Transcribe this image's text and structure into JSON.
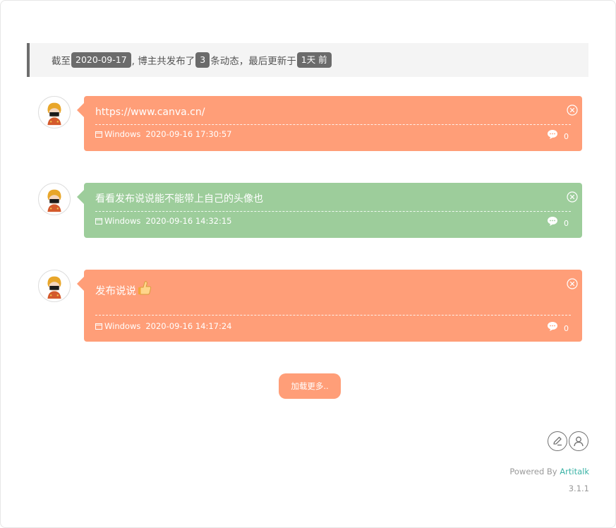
{
  "summary": {
    "prefix": "截至",
    "date": "2020-09-17",
    "middle": ", 博主共发布了",
    "count": "3",
    "suffix": "条动态，最后更新于",
    "updated": "1天 前"
  },
  "posts": [
    {
      "content": "https://www.canva.cn/",
      "os": "Windows",
      "datetime": "2020-09-16 17:30:57",
      "comments": "0",
      "color": "#ff9e78"
    },
    {
      "content": "看看发布说说能不能带上自己的头像也",
      "os": "Windows",
      "datetime": "2020-09-16 14:32:15",
      "comments": "0",
      "color": "#9dcd9b"
    },
    {
      "content": "发布说说",
      "emoji": "thumbs-up-icon",
      "os": "Windows",
      "datetime": "2020-09-16 14:17:24",
      "comments": "0",
      "color": "#ff9e78"
    }
  ],
  "load_more_label": "加载更多..",
  "footer": {
    "powered_prefix": "Powered By ",
    "powered_link": "Artitalk",
    "version": "3.1.1",
    "link_color": "#3bb3a6"
  },
  "icons": {
    "edit": "edit-icon",
    "user": "user-icon",
    "close": "close-icon",
    "comment": "comment-icon",
    "os": "window-icon"
  }
}
